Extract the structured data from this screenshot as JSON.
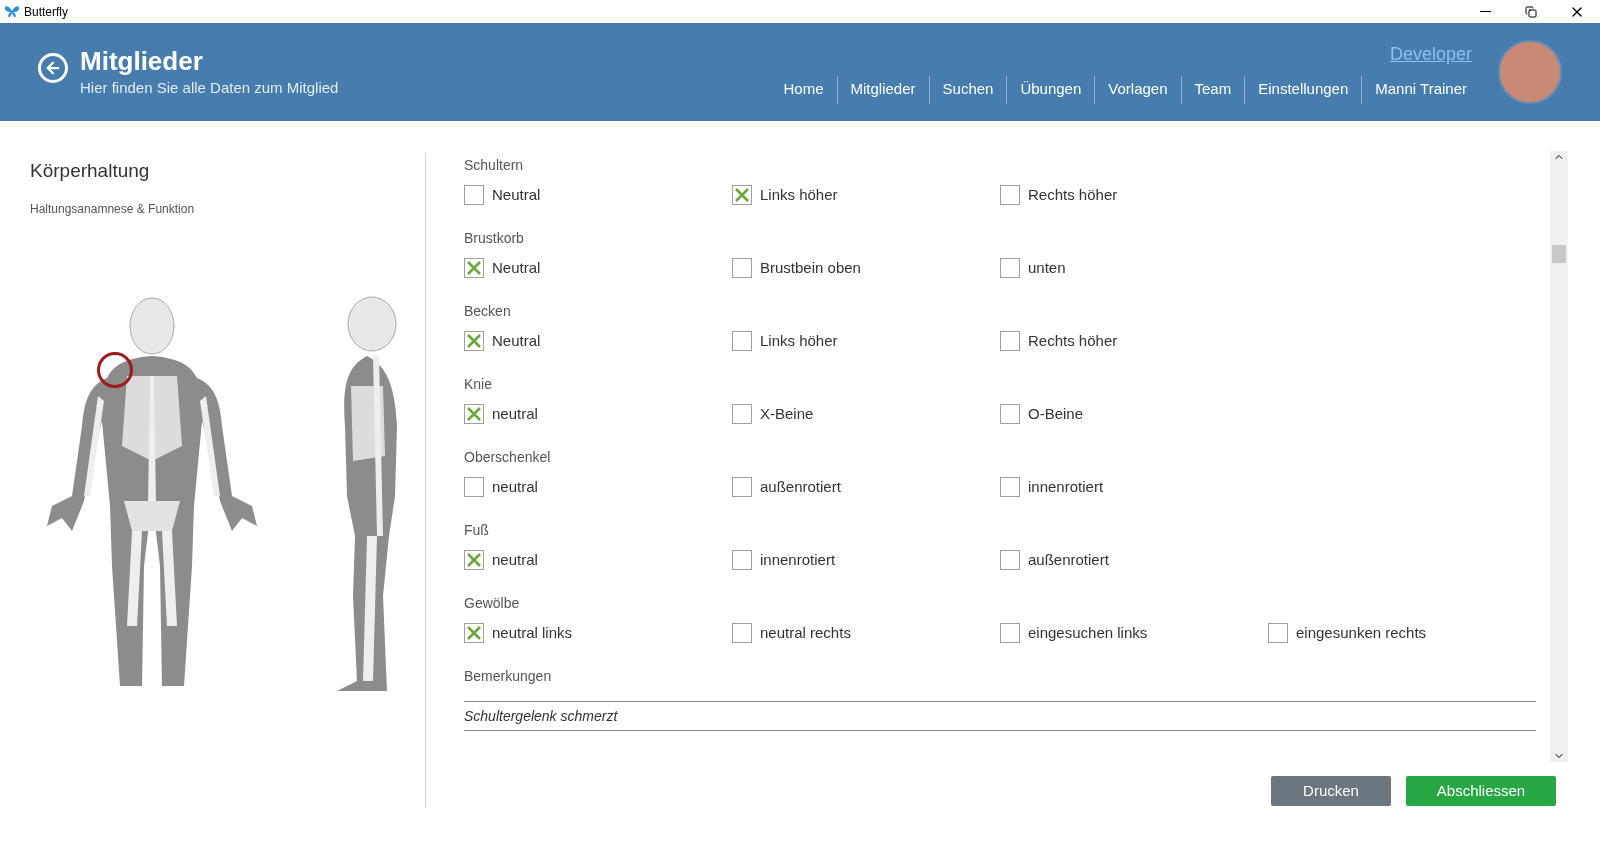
{
  "window": {
    "title": "Butterfly"
  },
  "header": {
    "title": "Mitglieder",
    "subtitle": "Hier finden Sie alle Daten zum Mitglied",
    "user_link": "Developer",
    "nav": [
      {
        "label": "Home"
      },
      {
        "label": "Mitglieder"
      },
      {
        "label": "Suchen"
      },
      {
        "label": "Übungen"
      },
      {
        "label": "Vorlagen"
      },
      {
        "label": "Team"
      },
      {
        "label": "Einstellungen"
      },
      {
        "label": "Manni Trainer"
      }
    ]
  },
  "side_panel": {
    "title": "Körperhaltung",
    "subtitle": "Haltungsanamnese & Funktion"
  },
  "groups": [
    {
      "label": "Schultern",
      "options": [
        {
          "label": "Neutral",
          "checked": false
        },
        {
          "label": "Links höher",
          "checked": true
        },
        {
          "label": "Rechts höher",
          "checked": false
        }
      ]
    },
    {
      "label": "Brustkorb",
      "options": [
        {
          "label": "Neutral",
          "checked": true
        },
        {
          "label": "Brustbein oben",
          "checked": false
        },
        {
          "label": "unten",
          "checked": false
        }
      ]
    },
    {
      "label": "Becken",
      "options": [
        {
          "label": "Neutral",
          "checked": true
        },
        {
          "label": "Links höher",
          "checked": false
        },
        {
          "label": "Rechts höher",
          "checked": false
        }
      ]
    },
    {
      "label": "Knie",
      "options": [
        {
          "label": "neutral",
          "checked": true
        },
        {
          "label": "X-Beine",
          "checked": false
        },
        {
          "label": "O-Beine",
          "checked": false
        }
      ]
    },
    {
      "label": "Oberschenkel",
      "options": [
        {
          "label": "neutral",
          "checked": false
        },
        {
          "label": "außenrotiert",
          "checked": false
        },
        {
          "label": "innenrotiert",
          "checked": false
        }
      ]
    },
    {
      "label": "Fuß",
      "options": [
        {
          "label": "neutral",
          "checked": true
        },
        {
          "label": "innenrotiert",
          "checked": false
        },
        {
          "label": "außenrotiert",
          "checked": false
        }
      ]
    },
    {
      "label": "Gewölbe",
      "options": [
        {
          "label": "neutral links",
          "checked": true
        },
        {
          "label": "neutral rechts",
          "checked": false
        },
        {
          "label": "eingesuchen links",
          "checked": false
        },
        {
          "label": "eingesunken rechts",
          "checked": false
        }
      ]
    }
  ],
  "remarks": {
    "label": "Bemerkungen",
    "value": "Schultergelenk schmerzt"
  },
  "buttons": [
    {
      "label": "Drucken",
      "kind": "secondary"
    },
    {
      "label": "Abschliessen",
      "kind": "primary"
    }
  ]
}
